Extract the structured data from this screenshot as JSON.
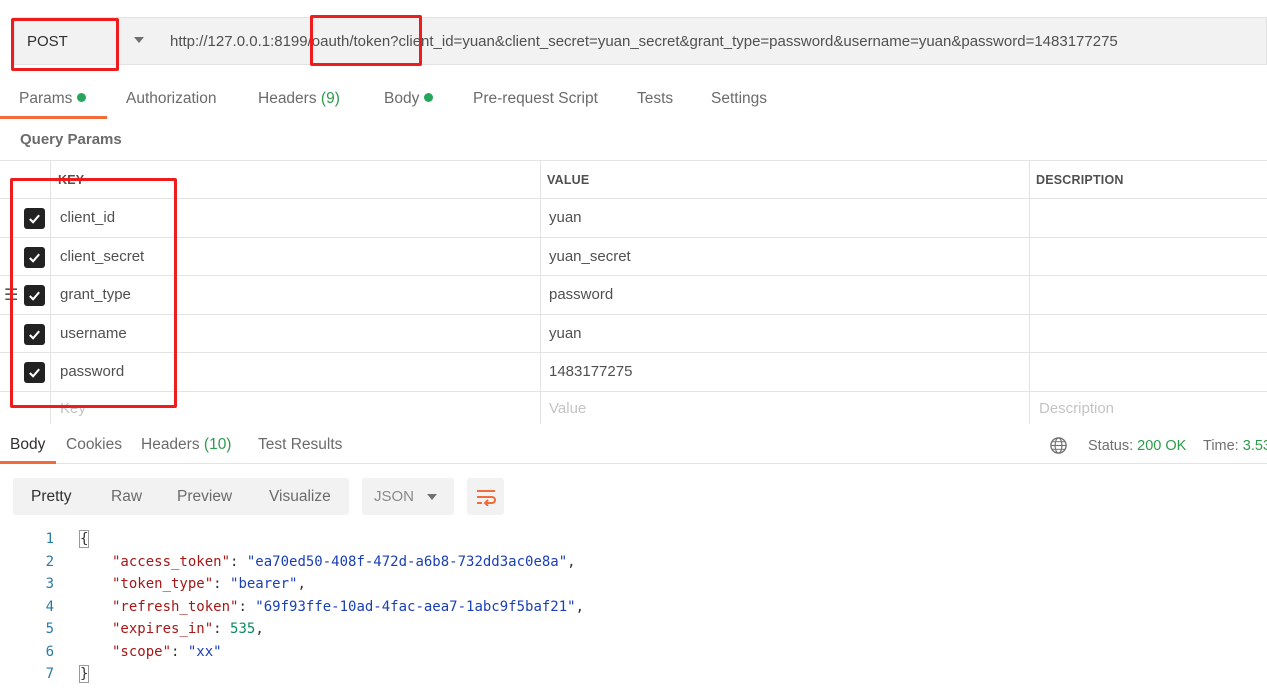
{
  "request": {
    "method": "POST",
    "url": "http://127.0.0.1:8199/oauth/token?client_id=yuan&client_secret=yuan_secret&grant_type=password&username=yuan&password=1483177275"
  },
  "request_tabs": [
    {
      "label": "Params",
      "count": "",
      "dot": true
    },
    {
      "label": "Authorization",
      "count": "",
      "dot": false
    },
    {
      "label": "Headers",
      "count": "(9)",
      "dot": false
    },
    {
      "label": "Body",
      "count": "",
      "dot": true
    },
    {
      "label": "Pre-request Script",
      "count": "",
      "dot": false
    },
    {
      "label": "Tests",
      "count": "",
      "dot": false
    },
    {
      "label": "Settings",
      "count": "",
      "dot": false
    }
  ],
  "query_params": {
    "title": "Query Params",
    "headers": {
      "key": "KEY",
      "value": "VALUE",
      "description": "DESCRIPTION"
    },
    "rows": [
      {
        "key": "client_id",
        "value": "yuan"
      },
      {
        "key": "client_secret",
        "value": "yuan_secret"
      },
      {
        "key": "grant_type",
        "value": "password"
      },
      {
        "key": "username",
        "value": "yuan"
      },
      {
        "key": "password",
        "value": "1483177275"
      }
    ],
    "placeholders": {
      "key": "Key",
      "value": "Value",
      "description": "Description"
    }
  },
  "response_tabs": [
    {
      "label": "Body",
      "count": ""
    },
    {
      "label": "Cookies",
      "count": ""
    },
    {
      "label": "Headers",
      "count": "(10)"
    },
    {
      "label": "Test Results",
      "count": ""
    }
  ],
  "status": {
    "status_label": "Status:",
    "status_value": "200 OK",
    "time_label": "Time:",
    "time_value": "3.53"
  },
  "view_modes": [
    "Pretty",
    "Raw",
    "Preview",
    "Visualize"
  ],
  "format": "JSON",
  "response_body": {
    "line_numbers": [
      "1",
      "2",
      "3",
      "4",
      "5",
      "6",
      "7"
    ],
    "open": "{",
    "close": "}",
    "fields": [
      {
        "key": "\"access_token\"",
        "value": "\"ea70ed50-408f-472d-a6b8-732dd3ac0e8a\"",
        "kind": "string"
      },
      {
        "key": "\"token_type\"",
        "value": "\"bearer\"",
        "kind": "string"
      },
      {
        "key": "\"refresh_token\"",
        "value": "\"69f93ffe-10ad-4fac-aea7-1abc9f5baf21\"",
        "kind": "string"
      },
      {
        "key": "\"expires_in\"",
        "value": "535",
        "kind": "number"
      },
      {
        "key": "\"scope\"",
        "value": "\"xx\"",
        "kind": "string"
      }
    ]
  },
  "icons": {
    "method_dropdown": "chevron-down-icon",
    "checkbox": "check-icon",
    "drag": "drag-handle-icon",
    "globe": "globe-icon",
    "wrap": "wrap-lines-icon"
  },
  "colors": {
    "accent": "#f26b3a",
    "ok": "#2d9b4b",
    "annotation": "#ee1c1c"
  }
}
